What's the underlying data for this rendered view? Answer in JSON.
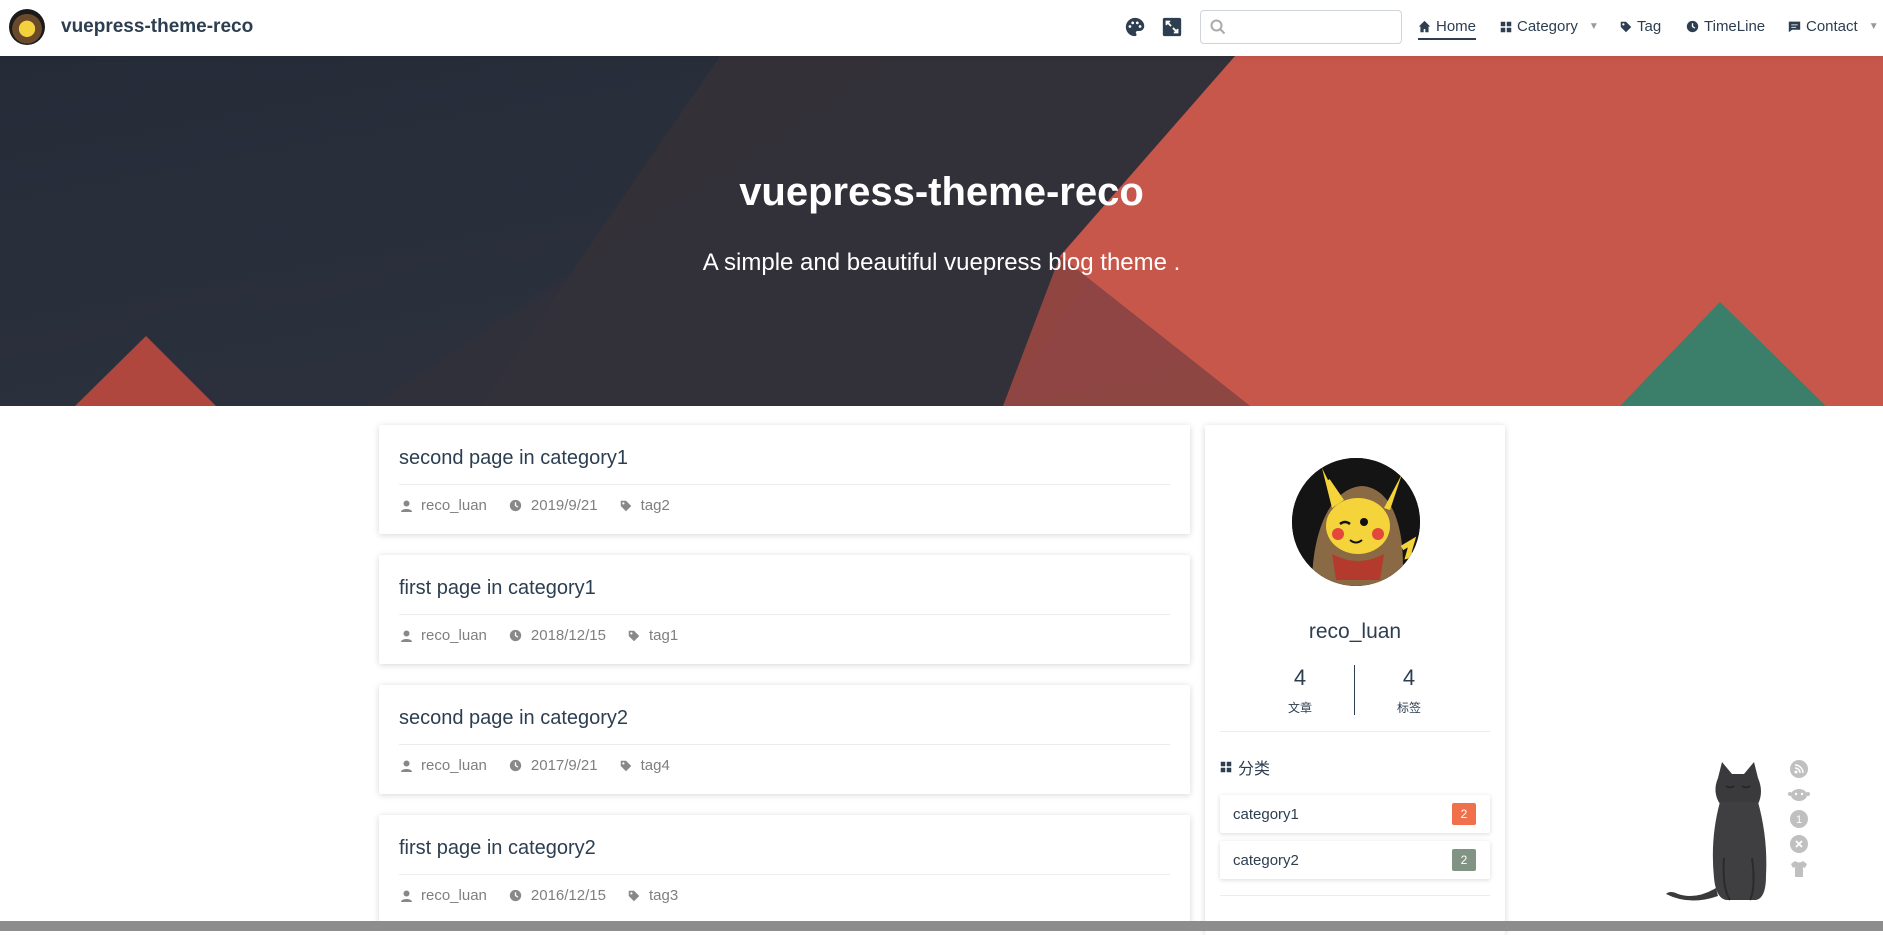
{
  "navbar": {
    "site_name": "vuepress-theme-reco",
    "search_placeholder": "",
    "items": [
      {
        "label": "Home",
        "icon": "home-icon",
        "active": true
      },
      {
        "label": "Category",
        "icon": "category-icon",
        "dropdown": true
      },
      {
        "label": "Tag",
        "icon": "tag-icon"
      },
      {
        "label": "TimeLine",
        "icon": "clock-icon"
      },
      {
        "label": "Contact",
        "icon": "message-icon",
        "dropdown": true
      }
    ],
    "tools": [
      "palette-icon",
      "fullscreen-icon"
    ]
  },
  "hero": {
    "title": "vuepress-theme-reco",
    "subtitle": "A simple and beautiful vuepress blog theme ."
  },
  "posts": [
    {
      "title": "second page in category1",
      "author": "reco_luan",
      "date": "2019/9/21",
      "tag": "tag2"
    },
    {
      "title": "first page in category1",
      "author": "reco_luan",
      "date": "2018/12/15",
      "tag": "tag1"
    },
    {
      "title": "second page in category2",
      "author": "reco_luan",
      "date": "2017/9/21",
      "tag": "tag4"
    },
    {
      "title": "first page in category2",
      "author": "reco_luan",
      "date": "2016/12/15",
      "tag": "tag3"
    }
  ],
  "sidebar": {
    "author": "reco_luan",
    "stats": [
      {
        "num": "4",
        "label": "文章"
      },
      {
        "num": "4",
        "label": "标签"
      }
    ],
    "category_heading": "分类",
    "categories": [
      {
        "name": "category1",
        "count": "2",
        "color": "#f1704c"
      },
      {
        "name": "category2",
        "count": "2",
        "color": "#819483"
      }
    ]
  },
  "widget_tools": [
    "rss-icon",
    "monkey-icon",
    "info-icon",
    "close-icon",
    "shirt-icon"
  ],
  "colors": {
    "accent": "#2c3e50",
    "hero_red": "#c8574b",
    "hero_dark": "#2b2f38",
    "hero_green": "#3b7f6b"
  }
}
